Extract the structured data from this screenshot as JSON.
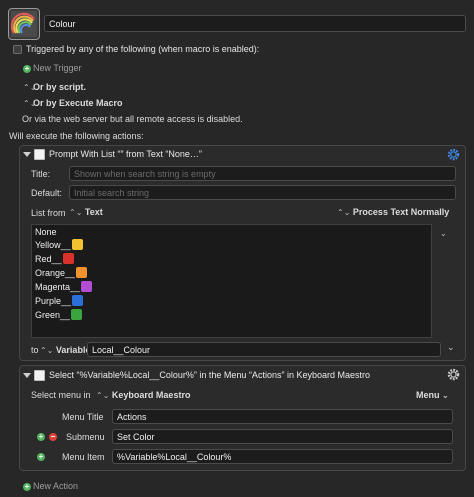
{
  "macro": {
    "name": "Colour",
    "icon": "rainbow-icon"
  },
  "triggers": {
    "triggered_label": "Triggered by any of the following (when macro is enabled):",
    "new_trigger": "New Trigger",
    "by_script": "Or by script.",
    "by_execute_macro": "Or by Execute Macro",
    "web_server": "Or via the web server but all remote access is disabled.",
    "will_execute": "Will execute the following actions:"
  },
  "action1": {
    "title": "Prompt With List “” from Text “None…”",
    "title_label": "Title:",
    "title_placeholder": "Shown when search string is empty",
    "default_label": "Default:",
    "default_placeholder": "Initial search string",
    "list_from_label": "List from",
    "list_from_value": "Text",
    "process_text": "Process Text Normally",
    "items": [
      {
        "label": "None",
        "swatch": ""
      },
      {
        "label": "Yellow__",
        "swatch": "#f3c02f"
      },
      {
        "label": "Red__",
        "swatch": "#d8322a"
      },
      {
        "label": "Orange__",
        "swatch": "#f0932e"
      },
      {
        "label": "Magenta__",
        "swatch": "#b24ed4"
      },
      {
        "label": "Purple__",
        "swatch": "#2c6fd9"
      },
      {
        "label": "Green__",
        "swatch": "#3aa53f"
      }
    ],
    "to_label": "to",
    "variable_label": "Variable",
    "variable_value": "Local__Colour"
  },
  "action2": {
    "title": "Select “%Variable%Local__Colour%” in the Menu “Actions” in Keyboard Maestro",
    "select_menu_label": "Select menu in",
    "app_value": "Keyboard Maestro",
    "menu_popup": "Menu",
    "menu_title_label": "Menu Title",
    "menu_title_value": "Actions",
    "submenu_label": "Submenu",
    "submenu_value": "Set Color",
    "menu_item_label": "Menu Item",
    "menu_item_value": "%Variable%Local__Colour%"
  },
  "footer": {
    "new_action": "New Action"
  },
  "colors": {
    "background": "#272727",
    "field": "#1c1c1c",
    "add": "#53b25d",
    "remove": "#d8443c",
    "gear_blue": "#3f86e0"
  }
}
